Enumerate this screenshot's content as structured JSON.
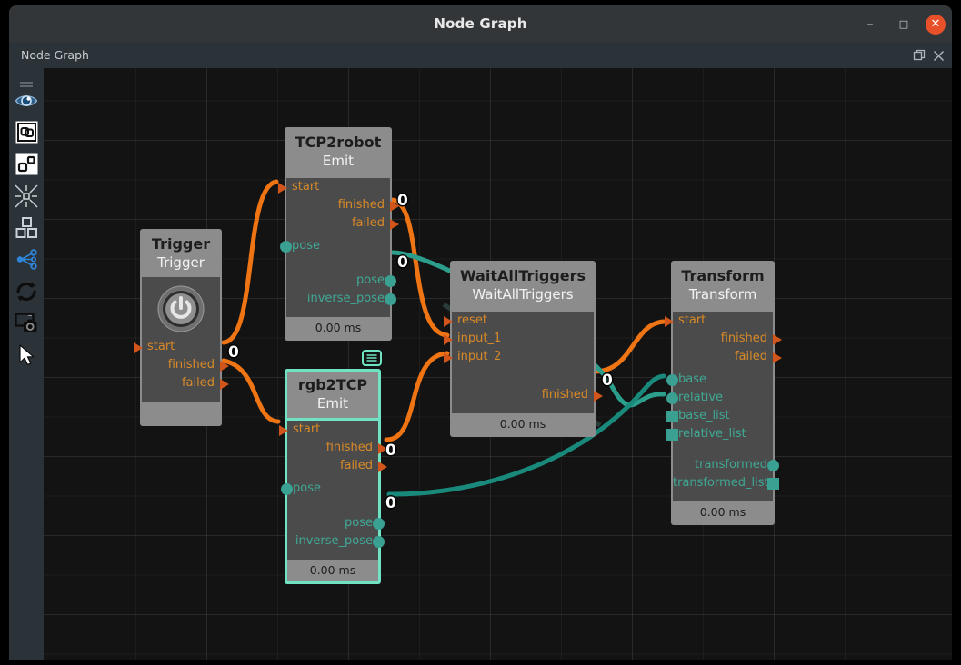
{
  "window": {
    "title": "Node Graph",
    "buttons": [
      {
        "name": "minimize-button",
        "glyph": "–"
      },
      {
        "name": "maximize-button",
        "glyph": "□"
      },
      {
        "name": "close-button",
        "glyph": "✕"
      }
    ]
  },
  "panel": {
    "title": "Node Graph",
    "actions": [
      {
        "name": "float-panel-button",
        "icon": "float-icon"
      },
      {
        "name": "close-panel-button",
        "icon": "close-icon"
      }
    ]
  },
  "toolbar": {
    "items": [
      {
        "name": "drag-handle",
        "icon": "grip-handle-icon",
        "interactable": false
      },
      {
        "name": "visibility-tool",
        "icon": "eye-icon"
      },
      {
        "name": "group-select-tool",
        "icon": "framed-nodes-icon"
      },
      {
        "name": "node-layout-tool",
        "icon": "two-squares-icon"
      },
      {
        "name": "collapse-tool",
        "icon": "collapse-arrows-icon"
      },
      {
        "name": "arrange-tool",
        "icon": "four-squares-icon"
      },
      {
        "name": "graph-connect-tool",
        "icon": "share-nodes-icon"
      },
      {
        "name": "refresh-tool",
        "icon": "refresh-arrows-icon"
      },
      {
        "name": "screenshot-tool",
        "icon": "screen-camera-icon"
      },
      {
        "name": "pointer-tool",
        "icon": "cursor-arrow-icon"
      }
    ]
  },
  "colors": {
    "exec_wire": "#ee7414",
    "data_wire": "#18897b",
    "exec_port": "#d2561b",
    "data_port": "#3aa092",
    "selection": "#6fe3c4",
    "node_header": "#8c8c8c",
    "node_body": "#4b4b4b",
    "canvas": "#131313"
  },
  "nodes": [
    {
      "id": "trigger",
      "name": "Trigger",
      "type": "Trigger",
      "time": "",
      "selected": false,
      "has_power_icon": true,
      "inputs_exec": [
        "start"
      ],
      "outputs_exec": [
        "finished",
        "failed"
      ],
      "inputs_data": [],
      "outputs_data": []
    },
    {
      "id": "tcp2robot",
      "name": "TCP2robot",
      "type": "Emit",
      "time": "0.00 ms",
      "selected": false,
      "has_power_icon": false,
      "inputs_exec": [
        "start"
      ],
      "outputs_exec": [
        "finished",
        "failed"
      ],
      "inputs_data": [
        "pose"
      ],
      "outputs_data": [
        "pose",
        "inverse_pose"
      ]
    },
    {
      "id": "rgb2tcp",
      "name": "rgb2TCP",
      "type": "Emit",
      "time": "0.00 ms",
      "selected": true,
      "has_power_icon": false,
      "badge_icon": "list-lines-icon",
      "inputs_exec": [
        "start"
      ],
      "outputs_exec": [
        "finished",
        "failed"
      ],
      "inputs_data": [
        "pose"
      ],
      "outputs_data": [
        "pose",
        "inverse_pose"
      ]
    },
    {
      "id": "waitalltriggers",
      "name": "WaitAllTriggers",
      "type": "WaitAllTriggers",
      "time": "0.00 ms",
      "selected": false,
      "has_power_icon": false,
      "inputs_exec": [
        "reset",
        "input_1",
        "input_2"
      ],
      "outputs_exec": [
        "finished"
      ],
      "inputs_data": [],
      "outputs_data": []
    },
    {
      "id": "transform",
      "name": "Transform",
      "type": "Transform",
      "time": "0.00 ms",
      "selected": false,
      "has_power_icon": false,
      "inputs_exec": [
        "start"
      ],
      "outputs_exec": [
        "finished",
        "failed"
      ],
      "inputs_data": [
        "base",
        "relative",
        "base_list",
        "relative_list"
      ],
      "outputs_data": [
        "transformed",
        "transformed_list"
      ]
    }
  ],
  "wire_badges": [
    {
      "name": "wire-badge-trigger-out",
      "label": "0"
    },
    {
      "name": "wire-badge-tcp2robot-exec",
      "label": "0"
    },
    {
      "name": "wire-badge-tcp2robot-pose",
      "label": "0"
    },
    {
      "name": "wire-badge-rgb2tcp-exec",
      "label": "0"
    },
    {
      "name": "wire-badge-rgb2tcp-pose",
      "label": "0"
    },
    {
      "name": "wire-badge-waitalltriggers-finished",
      "label": "0"
    }
  ]
}
